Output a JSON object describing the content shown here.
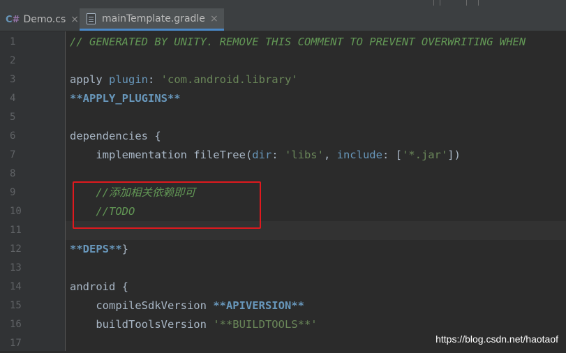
{
  "tabs": [
    {
      "label": "Demo.cs",
      "badge_c": "C",
      "badge_hash": "#",
      "close": "×"
    },
    {
      "label": "mainTemplate.gradle",
      "close": "×",
      "active": true
    }
  ],
  "line_numbers": [
    "1",
    "2",
    "3",
    "4",
    "5",
    "6",
    "7",
    "8",
    "9",
    "10",
    "11",
    "12",
    "13",
    "14",
    "15",
    "16",
    "17"
  ],
  "code": {
    "l1": "// GENERATED BY UNITY. REMOVE THIS COMMENT TO PREVENT OVERWRITING WHEN",
    "l3": {
      "apply": "apply ",
      "plugin": "plugin",
      "colon": ": ",
      "lib": "'com.android.library'"
    },
    "l4": "**APPLY_PLUGINS**",
    "l6": "dependencies {",
    "l7": {
      "impl": "    implementation fileTree(",
      "dir": "dir",
      "c1": ": ",
      "libs": "'libs'",
      "comma": ", ",
      "include": "include",
      "c2": ": [",
      "jar": "'*.jar'",
      "end": "])"
    },
    "l9": "    //添加相关依赖即可",
    "l10": "    //TODO",
    "l12": {
      "deps": "**DEPS**",
      "brace": "}"
    },
    "l14": "android {",
    "l15": {
      "name": "    compileSdkVersion ",
      "ph": "**APIVERSION**"
    },
    "l16": {
      "name": "    buildToolsVersion ",
      "str": "'**BUILDTOOLS**'"
    }
  },
  "watermark": "https://blog.csdn.net/haotaof",
  "colors": {
    "background": "#2b2b2b",
    "gutter": "#313335",
    "comment": "#629755",
    "string": "#6a8759",
    "keyword": "#6897bb",
    "highlight_box": "#e0191e"
  }
}
